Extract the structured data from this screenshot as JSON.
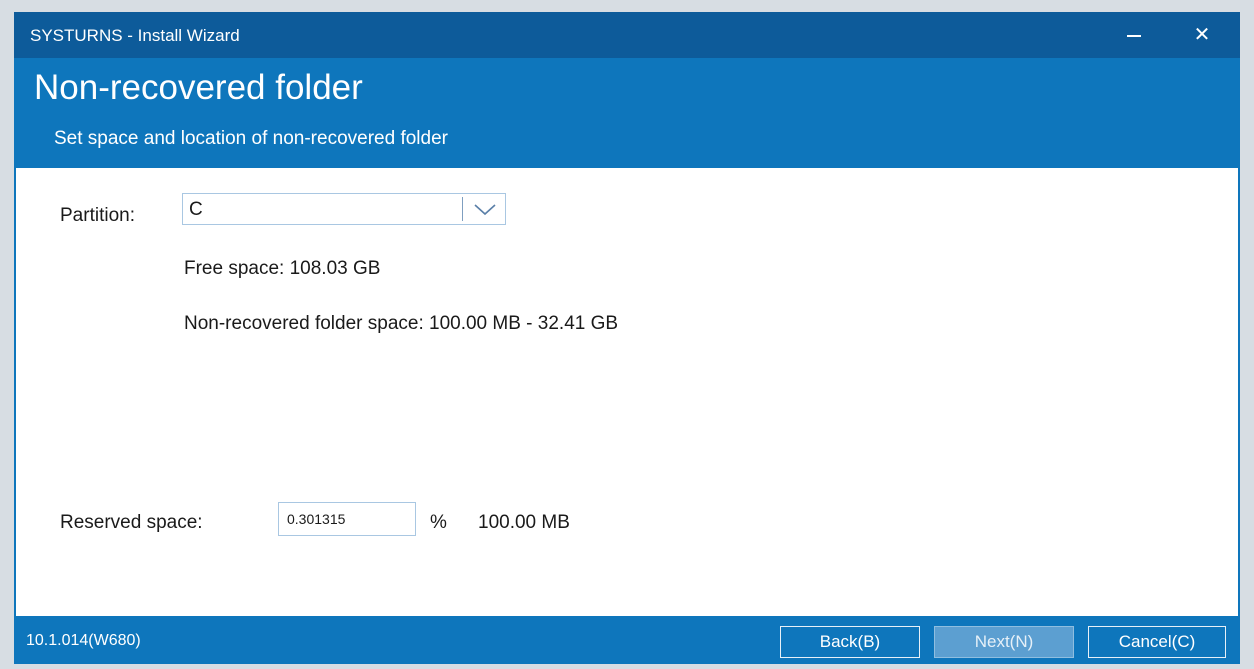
{
  "window": {
    "title": "SYSTURNS  -  Install Wizard",
    "minimize_icon": "minimize-icon",
    "close_glyph": "✕"
  },
  "header": {
    "title": "Non-recovered folder",
    "subtitle": "Set space and location of non-recovered folder"
  },
  "content": {
    "partition_label": "Partition:",
    "partition_value": "C",
    "free_space": "Free space:  108.03 GB",
    "folder_space": "Non-recovered folder space:  100.00 MB - 32.41 GB",
    "reserved_label": "Reserved space:",
    "reserved_value": "0.301315",
    "percent_sign": "%",
    "reserved_mb": "100.00 MB"
  },
  "footer": {
    "version": "10.1.014(W680)",
    "back_label": "Back(B)",
    "next_label": "Next(N)",
    "cancel_label": "Cancel(C)"
  },
  "colors": {
    "titlebar": "#0d5b9a",
    "accent": "#0e76bc",
    "content_bg": "#ffffff",
    "disabled_button": "#5c9fd1"
  }
}
